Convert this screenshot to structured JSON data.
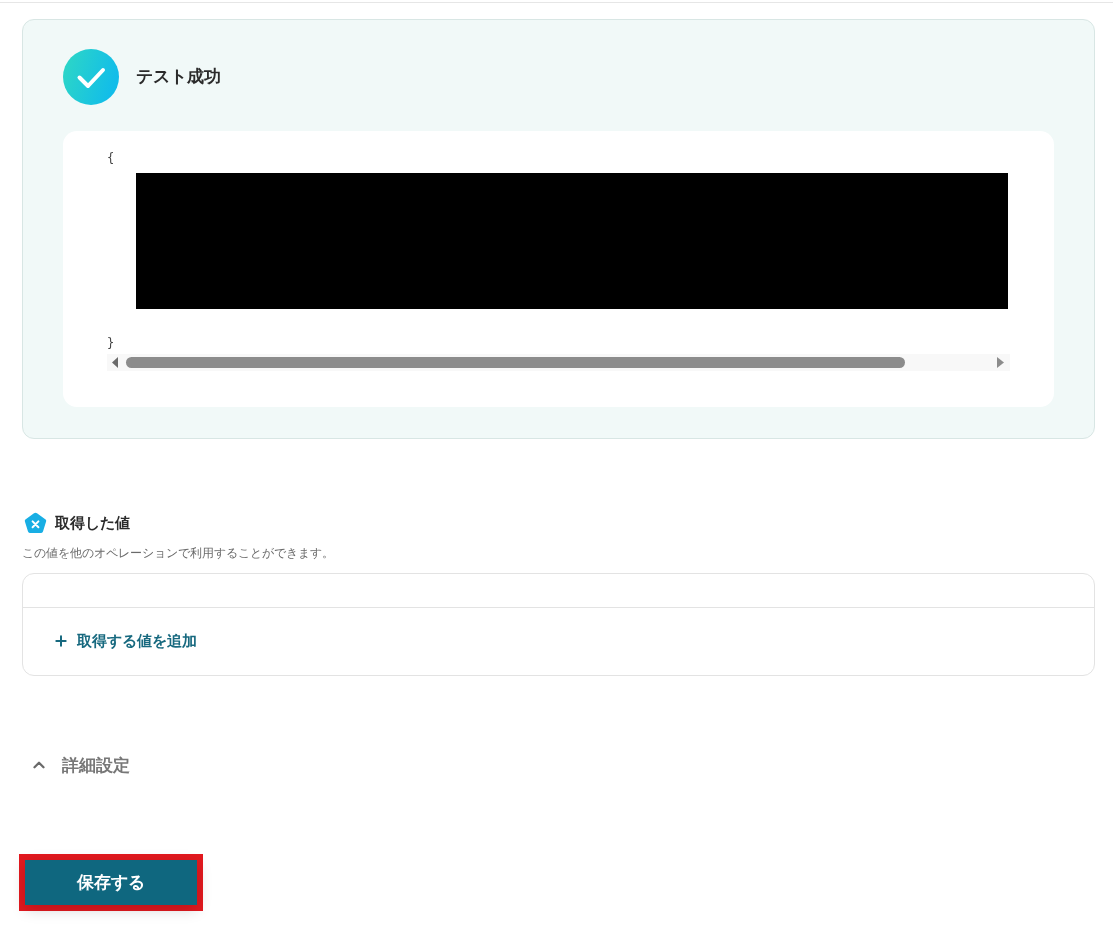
{
  "result_card": {
    "status_title": "テスト成功",
    "output": {
      "open_brace": "{",
      "close_brace": "}"
    }
  },
  "acquired_values": {
    "title": "取得した値",
    "description": "この値を他のオペレーションで利用することができます。",
    "add_button": {
      "label": "取得する値を追加"
    }
  },
  "advanced_settings": {
    "label": "詳細設定",
    "expanded": true
  },
  "save_button": {
    "label": "保存する",
    "highlighted": true
  }
}
